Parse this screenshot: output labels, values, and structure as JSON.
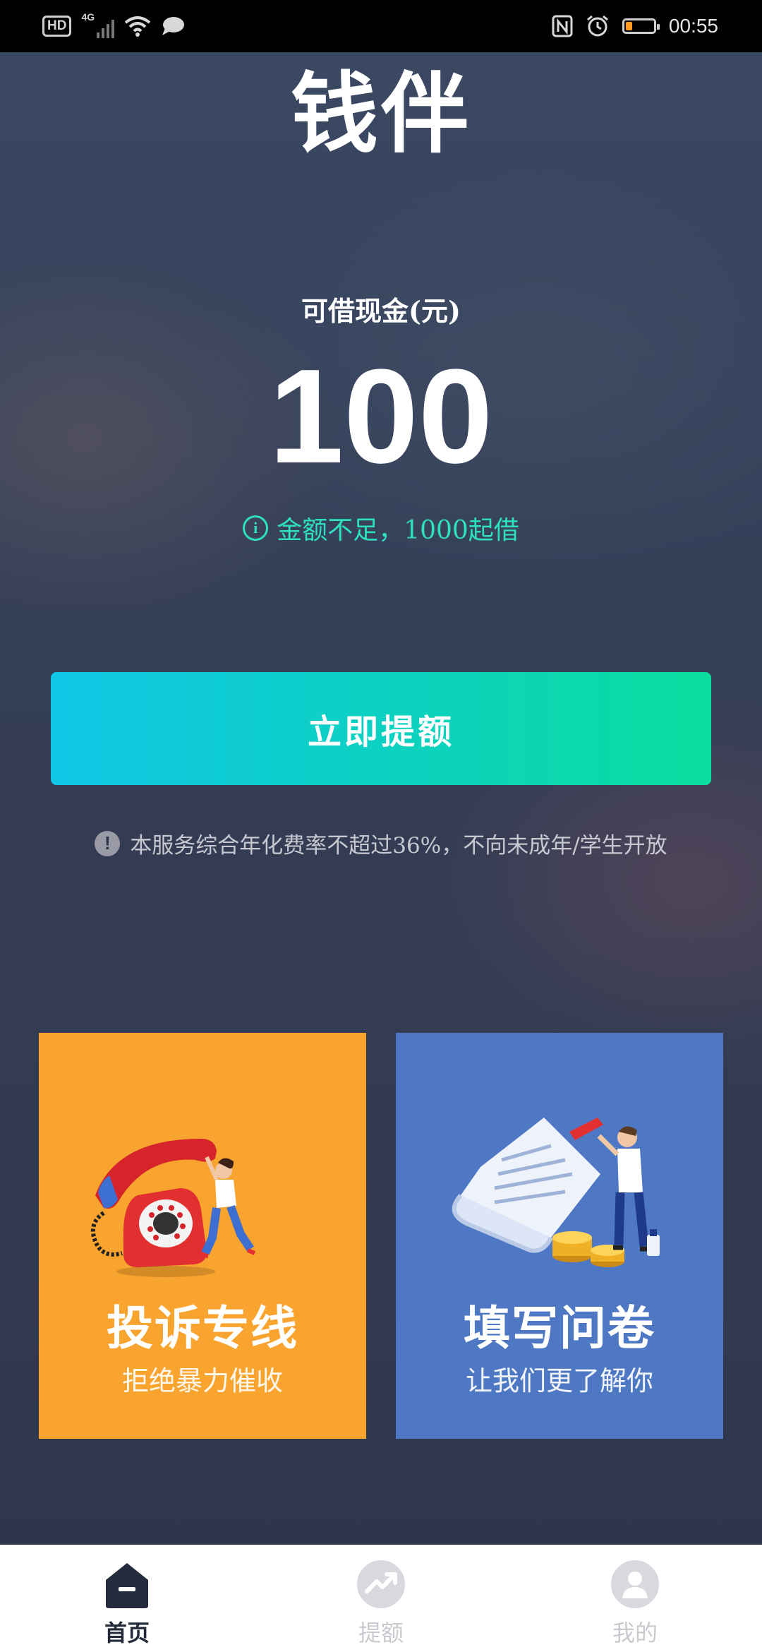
{
  "status_bar": {
    "network_badge": "HD",
    "network_type": "4G",
    "time": "00:55",
    "battery_level": 0.22,
    "icons": [
      "hd-icon",
      "signal-icon",
      "wifi-icon",
      "message-icon",
      "nfc-icon",
      "alarm-icon",
      "battery-icon"
    ]
  },
  "app": {
    "logo_char_1": "钱",
    "logo_char_2": "伴",
    "accent_color": "#ffc21a"
  },
  "loan": {
    "label": "可借现金(元)",
    "amount": "100",
    "note": "金额不足，1000起借",
    "note_color": "#2ee0c0"
  },
  "actions": {
    "raise_limit_label": "立即提额",
    "gradient_start": "#10c6e6",
    "gradient_end": "#0adc9e"
  },
  "disclaimer": {
    "text": "本服务综合年化费率不超过36%，不向未成年/学生开放"
  },
  "cards": {
    "complaint": {
      "title": "投诉专线",
      "subtitle": "拒绝暴力催收",
      "color": "#f8a42e",
      "icon": "telephone-icon"
    },
    "survey": {
      "title": "填写问卷",
      "subtitle": "让我们更了解你",
      "color": "#4f78c4",
      "icon": "questionnaire-icon"
    }
  },
  "nav": {
    "items": [
      {
        "label": "首页",
        "icon": "home-icon",
        "active": true
      },
      {
        "label": "提额",
        "icon": "trend-up-icon",
        "active": false
      },
      {
        "label": "我的",
        "icon": "user-icon",
        "active": false
      }
    ]
  }
}
